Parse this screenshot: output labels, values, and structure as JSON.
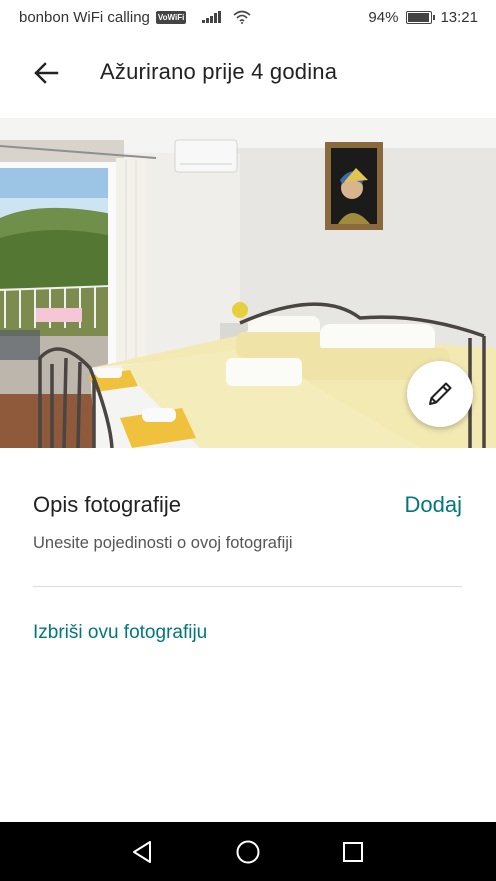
{
  "status_bar": {
    "carrier": "bonbon WiFi calling",
    "volte_badge": "VoWiFi",
    "battery": "94%",
    "battery_level": 0.94,
    "time": "13:21",
    "icons": [
      "signal-icon",
      "wifi-icon",
      "battery-icon"
    ]
  },
  "app_bar": {
    "back_icon": "arrow-left-icon",
    "title": "Ažurirano prije 4 godina"
  },
  "photo": {
    "subject": "bedroom-photo",
    "edit_icon": "pencil-icon"
  },
  "caption": {
    "label": "Opis fotografije",
    "action": "Dodaj",
    "placeholder": "Unesite pojedinosti o ovoj fotografiji"
  },
  "actions": {
    "delete_label": "Izbriši ovu fotografiju"
  },
  "colors": {
    "accent": "#00787a",
    "nav_bar": "#000000",
    "text": "#222222"
  },
  "nav_bar": {
    "icons": [
      "back-triangle-icon",
      "home-circle-icon",
      "recents-square-icon"
    ]
  }
}
